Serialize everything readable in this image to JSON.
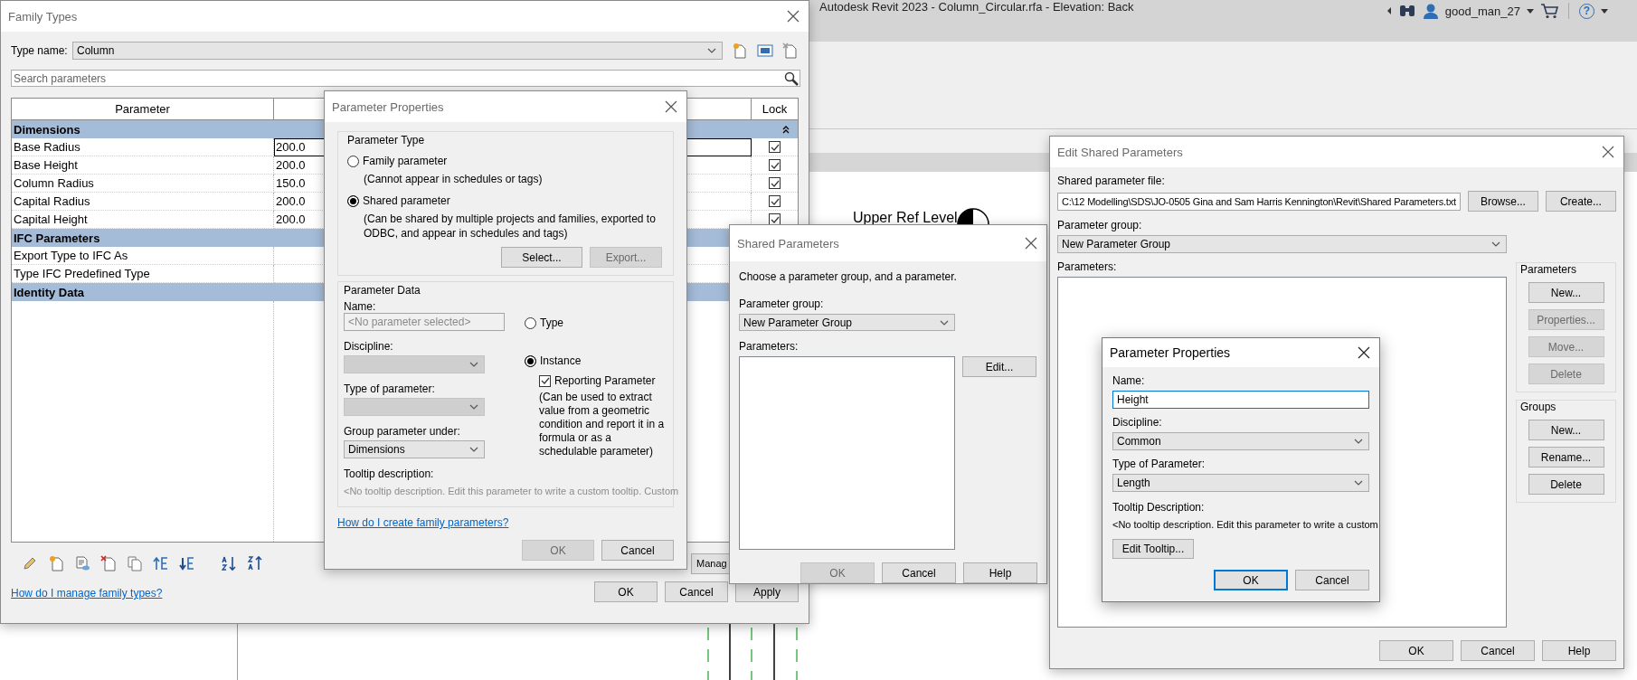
{
  "app": {
    "title": "Autodesk Revit 2023 - Column_Circular.rfa - Elevation: Back",
    "user": "good_man_27",
    "help_glyph": "?"
  },
  "canvas": {
    "level_label": "Upper Ref Level"
  },
  "family_types": {
    "title": "Family Types",
    "type_name_label": "Type name:",
    "type_name": "Column",
    "search_placeholder": "Search parameters",
    "columns": [
      "Parameter",
      "Lock"
    ],
    "groups": [
      {
        "name": "Dimensions",
        "expanded": true,
        "rows": [
          {
            "name": "Base Radius",
            "value": "200.0",
            "selected": true,
            "locked": true
          },
          {
            "name": "Base Height",
            "value": "200.0",
            "selected": false,
            "locked": true
          },
          {
            "name": "Column Radius",
            "value": "150.0",
            "selected": false,
            "locked": true
          },
          {
            "name": "Capital Radius",
            "value": "200.0",
            "selected": false,
            "locked": true
          },
          {
            "name": "Capital Height",
            "value": "200.0",
            "selected": false,
            "locked": true
          }
        ]
      },
      {
        "name": "IFC Parameters",
        "rows": [
          {
            "name": "Export Type to IFC As",
            "selected": false
          },
          {
            "name": "Type IFC Predefined Type",
            "selected": false
          }
        ]
      },
      {
        "name": "Identity Data"
      }
    ],
    "manage_button": "Manag",
    "link": "How do I manage family types?",
    "buttons": [
      {
        "label": "OK"
      },
      {
        "label": "Cancel"
      },
      {
        "label": "Apply"
      }
    ]
  },
  "parameter_properties": {
    "title": "Parameter Properties",
    "parameter_type": {
      "label": "Parameter Type",
      "options": [
        {
          "label": "Family parameter",
          "note": "(Cannot appear in schedules or tags)",
          "selected": false
        },
        {
          "label": "Shared parameter",
          "note": "(Can be shared by multiple projects and families, exported to ODBC, and appear in schedules and tags)",
          "selected": true
        }
      ],
      "buttons": [
        {
          "label": "Select...",
          "disabled": false
        },
        {
          "label": "Export...",
          "disabled": true
        }
      ]
    },
    "parameter_data": {
      "label": "Parameter Data",
      "name_label": "Name:",
      "name_placeholder": "<No parameter selected>",
      "discipline": {
        "label": "Discipline:",
        "disabled": true
      },
      "type_of_parameter": {
        "label": "Type of parameter:",
        "disabled": true
      },
      "group_under": {
        "label": "Group parameter under:",
        "value": "Dimensions",
        "disabled": false
      },
      "scope": [
        {
          "label": "Type",
          "selected": false
        },
        {
          "label": "Instance",
          "selected": true
        }
      ],
      "reporting": {
        "label": "Reporting Parameter",
        "checked": true,
        "note": "(Can be used to extract value from a geometric condition and report it in a formula or as a schedulable parameter)"
      },
      "tooltip_label": "Tooltip description:",
      "tooltip_text": "<No tooltip description. Edit this parameter to write a custom tooltip. Custom"
    },
    "link": "How do I create family parameters?",
    "buttons": [
      {
        "label": "OK",
        "disabled": true
      },
      {
        "label": "Cancel",
        "disabled": false
      }
    ]
  },
  "shared_parameters": {
    "title": "Shared Parameters",
    "instruction": "Choose a parameter group, and a parameter.",
    "group_label": "Parameter group:",
    "group_value": "New Parameter Group",
    "parameters_label": "Parameters:",
    "edit_button": "Edit...",
    "buttons": [
      {
        "label": "OK",
        "disabled": true
      },
      {
        "label": "Cancel",
        "disabled": false
      },
      {
        "label": "Help",
        "disabled": false
      }
    ]
  },
  "edit_shared_parameters": {
    "title": "Edit Shared Parameters",
    "file_label": "Shared parameter file:",
    "file_path": "C:\\12 Modelling\\SDS\\JO-0505 Gina and Sam Harris Kennington\\Revit\\Shared Parameters.txt",
    "file_buttons": [
      {
        "label": "Browse..."
      },
      {
        "label": "Create..."
      }
    ],
    "group_label": "Parameter group:",
    "group_value": "New Parameter Group",
    "parameters_label": "Parameters:",
    "side_groups": [
      {
        "label": "Parameters",
        "buttons": [
          {
            "label": "New...",
            "disabled": false
          },
          {
            "label": "Properties...",
            "disabled": true
          },
          {
            "label": "Move...",
            "disabled": true
          },
          {
            "label": "Delete",
            "disabled": true
          }
        ]
      },
      {
        "label": "Groups",
        "buttons": [
          {
            "label": "New...",
            "disabled": false
          },
          {
            "label": "Rename...",
            "disabled": false
          },
          {
            "label": "Delete",
            "disabled": false
          }
        ]
      }
    ],
    "buttons": [
      {
        "label": "OK"
      },
      {
        "label": "Cancel"
      },
      {
        "label": "Help"
      }
    ]
  },
  "new_parameter_properties": {
    "title": "Parameter Properties",
    "name_label": "Name:",
    "name_value": "Height",
    "discipline_label": "Discipline:",
    "discipline": "Common",
    "type_label": "Type of Parameter:",
    "type_value": "Length",
    "tooltip_label": "Tooltip Description:",
    "tooltip_text": "<No tooltip description. Edit this parameter to write a custom",
    "edit_tooltip_button": "Edit Tooltip...",
    "buttons": [
      {
        "label": "OK",
        "default": true
      },
      {
        "label": "Cancel",
        "default": false
      }
    ]
  }
}
